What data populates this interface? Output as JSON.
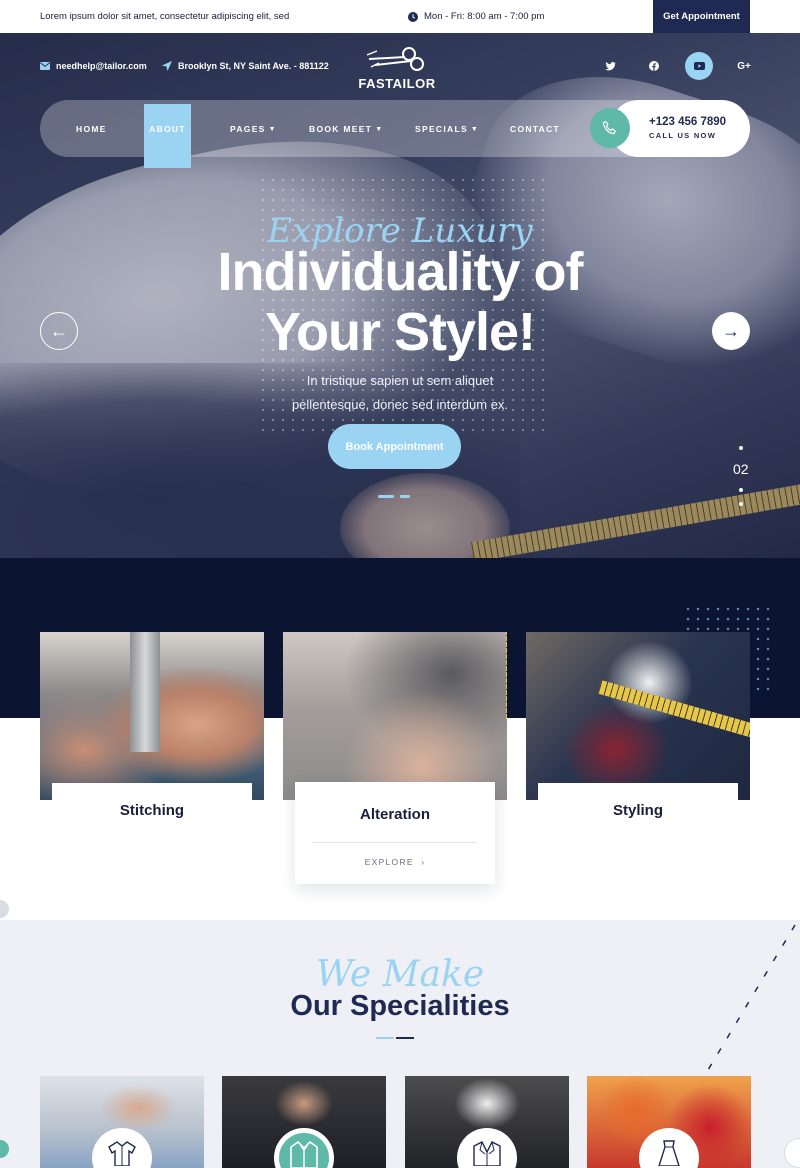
{
  "topbar": {
    "tagline": "Lorem ipsum dolor sit amet, consectetur adipiscing elit, sed",
    "hours": "Mon - Fri: 8:00 am - 7:00 pm",
    "cta": "Get Appointment"
  },
  "header": {
    "email": "needhelp@tailor.com",
    "address": "Brooklyn St, NY Saint Ave. - 881122",
    "logo": "FASTAILOR",
    "social": {
      "twitter": "twitter-icon",
      "facebook": "facebook-icon",
      "youtube": "youtube-icon",
      "google": "G+"
    }
  },
  "nav": {
    "items": [
      {
        "label": "HOME"
      },
      {
        "label": "ABOUT",
        "active": true
      },
      {
        "label": "PAGES",
        "dropdown": true
      },
      {
        "label": "BOOK MEET",
        "dropdown": true
      },
      {
        "label": "SPECIALS",
        "dropdown": true
      },
      {
        "label": "CONTACT"
      }
    ],
    "phone": "+123 456 7890",
    "phone_label": "CALL US NOW"
  },
  "hero": {
    "script": "Explore Luxury",
    "headline_1": "Individuality of",
    "headline_2": "Your Style!",
    "lead_1": "In tristique sapien ut sem aliquet",
    "lead_2": "pellentesque, donec sed interdum ex.",
    "button": "Book Appointment",
    "slide_number": "02"
  },
  "services": [
    {
      "title": "Stitching"
    },
    {
      "title": "Alteration",
      "link": "EXPLORE"
    },
    {
      "title": "Styling"
    }
  ],
  "specialities": {
    "script": "We Make",
    "title": "Our Specialities",
    "tiles": [
      {
        "icon": "shirt-icon"
      },
      {
        "icon": "tuxedo-icon"
      },
      {
        "icon": "suit-jacket-icon"
      },
      {
        "icon": "dress-icon"
      }
    ]
  },
  "colors": {
    "accent": "#9bd3f2",
    "navy": "#1f2a52",
    "teal": "#5fb9a9",
    "dark_band": "#0b1430"
  }
}
